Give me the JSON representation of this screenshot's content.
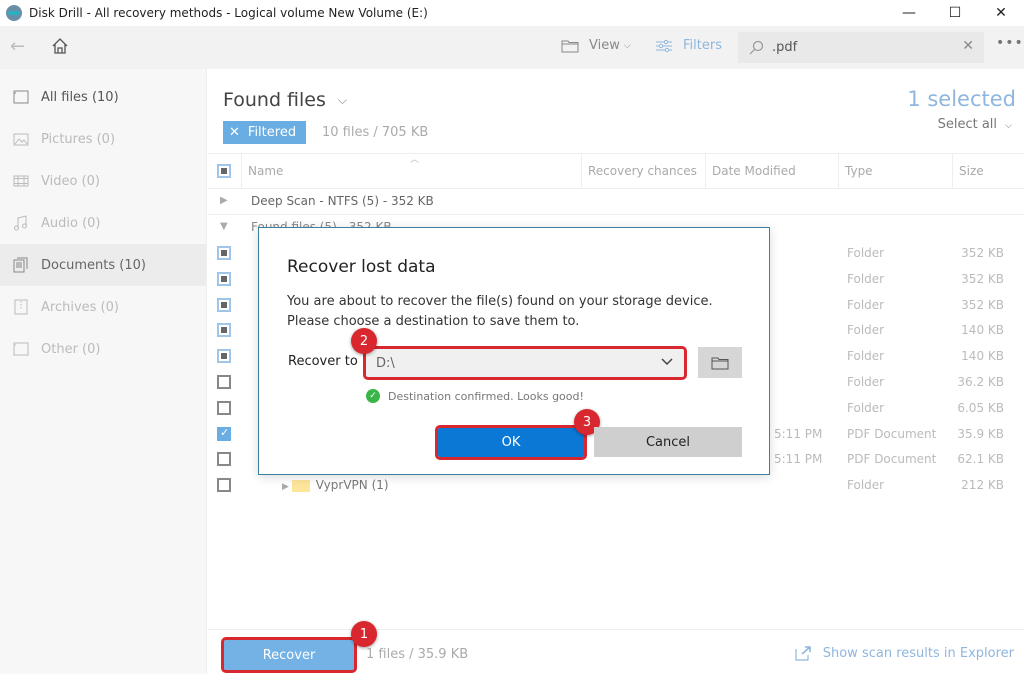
{
  "window": {
    "title": "Disk Drill - All recovery methods - Logical volume New Volume (E:)"
  },
  "toolbar": {
    "view_label": "View",
    "filters_label": "Filters",
    "search_value": ".pdf"
  },
  "sidebar": {
    "items": [
      {
        "label": "All files (10)",
        "icon": "all-files-icon"
      },
      {
        "label": "Pictures (0)",
        "icon": "pictures-icon"
      },
      {
        "label": "Video (0)",
        "icon": "video-icon"
      },
      {
        "label": "Audio (0)",
        "icon": "audio-icon"
      },
      {
        "label": "Documents (10)",
        "icon": "documents-icon"
      },
      {
        "label": "Archives (0)",
        "icon": "archives-icon"
      },
      {
        "label": "Other (0)",
        "icon": "other-icon"
      }
    ]
  },
  "main": {
    "title": "Found files",
    "filter_chip": "Filtered",
    "file_count": "10 files / 705 KB",
    "selected_count": "1 selected",
    "select_all": "Select all",
    "columns": [
      "Name",
      "Recovery chances",
      "Date Modified",
      "Type",
      "Size"
    ],
    "groups": [
      {
        "label": "Deep Scan - NTFS (5) - 352 KB",
        "expanded": false
      },
      {
        "label": "Found files (5) - 352 KB",
        "expanded": true
      }
    ],
    "rows": [
      {
        "check": "partial",
        "name": "",
        "date": "",
        "type": "Folder",
        "size": "352 KB"
      },
      {
        "check": "partial",
        "name": "",
        "date": "",
        "type": "Folder",
        "size": "352 KB"
      },
      {
        "check": "partial",
        "name": "",
        "date": "",
        "type": "Folder",
        "size": "352 KB"
      },
      {
        "check": "partial",
        "name": "",
        "date": "",
        "type": "Folder",
        "size": "140 KB"
      },
      {
        "check": "partial",
        "name": "",
        "date": "",
        "type": "Folder",
        "size": "140 KB"
      },
      {
        "check": "none",
        "name": "",
        "date": "",
        "type": "Folder",
        "size": "36.2 KB"
      },
      {
        "check": "none",
        "name": "",
        "date": "",
        "type": "Folder",
        "size": "6.05 KB"
      },
      {
        "check": "checked",
        "name": "",
        "date": "5:11 PM",
        "type": "PDF Document",
        "size": "35.9 KB"
      },
      {
        "check": "none",
        "name": "",
        "date": "5:11 PM",
        "type": "PDF Document",
        "size": "62.1 KB"
      },
      {
        "check": "none",
        "name": "VyprVPN (1)",
        "date": "",
        "type": "Folder",
        "size": "212 KB"
      }
    ]
  },
  "bottom": {
    "recover_label": "Recover",
    "selection_info": "1 files / 35.9 KB",
    "show_explorer": "Show scan results in Explorer"
  },
  "dialog": {
    "title": "Recover lost data",
    "message": "You are about to recover the file(s) found on your storage device. Please choose a destination to save them to.",
    "recover_to_label": "Recover to",
    "destination": "D:\\",
    "confirmation": "Destination confirmed. Looks good!",
    "ok_label": "OK",
    "cancel_label": "Cancel"
  },
  "annotations": {
    "step1": "1",
    "step2": "2",
    "step3": "3",
    "highlight_color": "#d8272e"
  }
}
